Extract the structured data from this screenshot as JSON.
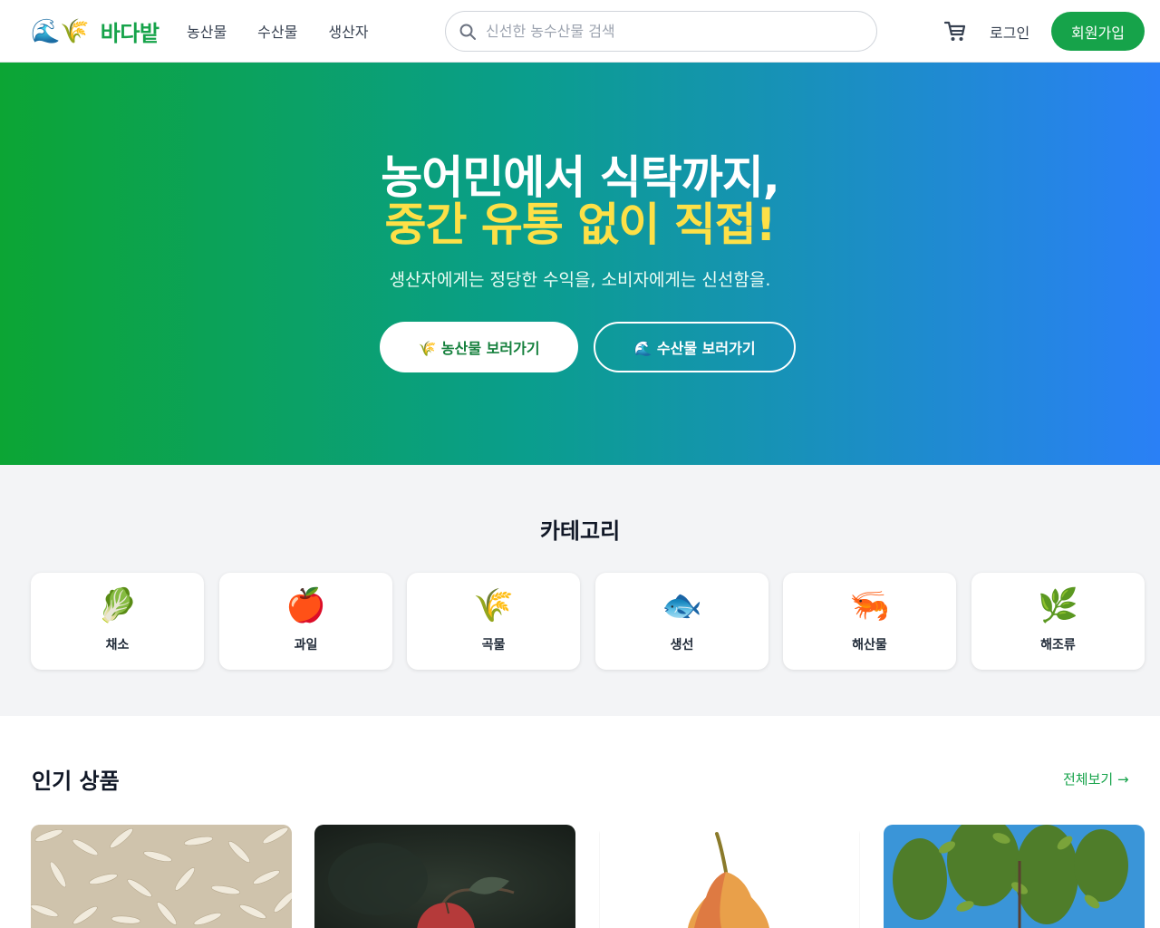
{
  "header": {
    "logo_icons": "🌊🌾",
    "logo_text": "바다밭",
    "nav": [
      "농산물",
      "수산물",
      "생산자"
    ],
    "search_placeholder": "신선한 농수산물 검색",
    "login_label": "로그인",
    "signup_label": "회원가입",
    "brand_color": "#16a34a"
  },
  "hero": {
    "title_line1": "농어민에서 식탁까지,",
    "title_line2": "중간 유통 없이 직접!",
    "subtitle": "생산자에게는 정당한 수익을, 소비자에게는 신선함을.",
    "btn_agri": "🌾 농산물 보러가기",
    "btn_fish": "🌊 수산물 보러가기",
    "gradient": [
      "#0ca534",
      "#0a9e8c",
      "#2a80f6"
    ],
    "highlight_color": "#fde047"
  },
  "categories": {
    "title": "카테고리",
    "items": [
      {
        "emoji": "🥬",
        "label": "채소"
      },
      {
        "emoji": "🍎",
        "label": "과일"
      },
      {
        "emoji": "🌾",
        "label": "곡물"
      },
      {
        "emoji": "🐟",
        "label": "생선"
      },
      {
        "emoji": "🦐",
        "label": "해산물"
      },
      {
        "emoji": "🌿",
        "label": "해조류"
      }
    ]
  },
  "popular": {
    "title": "인기 상품",
    "see_all": "전체보기 →",
    "products": [
      {
        "image": "rice-grains-photo"
      },
      {
        "image": "red-apple-photo"
      },
      {
        "image": "pear-photo"
      },
      {
        "image": "fruit-tree-photo"
      }
    ]
  }
}
